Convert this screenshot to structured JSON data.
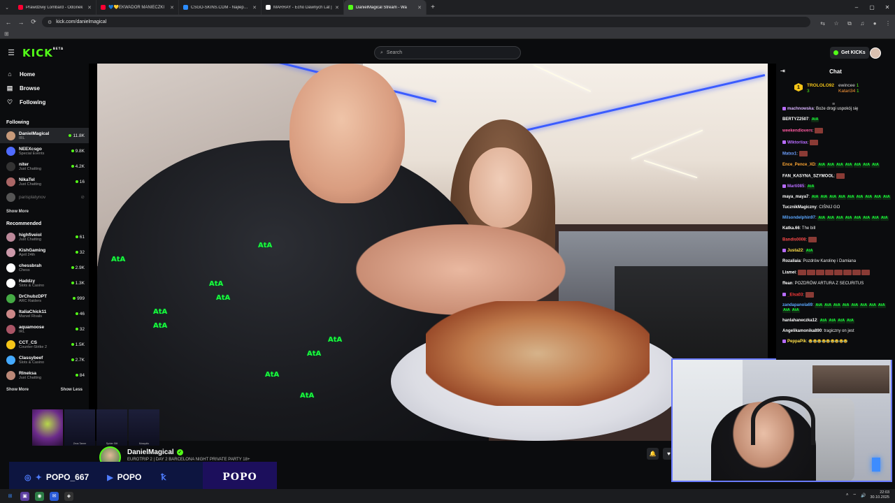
{
  "browser": {
    "tabs": [
      {
        "title": "Prawdziwy Lombard - Odcinek",
        "color": "#ff0033"
      },
      {
        "title": "💙💛EKWADOR MANIECZKI",
        "color": "#ff0033"
      },
      {
        "title": "CSGO-SKINS.COM - Najlepsze",
        "color": "#2b8cff"
      },
      {
        "title": "MARRAY - Echo Dawnych Lat |",
        "color": "#ffffff"
      },
      {
        "title": "DanielMagical Stream - Wa",
        "color": "#53fc18"
      }
    ],
    "url": "kick.com/danielmagical",
    "new_tab": "+",
    "menu": "⌄",
    "window_controls": [
      "–",
      "▢",
      "✕"
    ]
  },
  "header": {
    "logo": "KICK",
    "logo_badge": "BETA",
    "search_placeholder": "Search",
    "get_kicks": "Get KICKs"
  },
  "sidebar": {
    "nav": [
      {
        "label": "Home",
        "icon": "home-icon",
        "glyph": "⌂"
      },
      {
        "label": "Browse",
        "icon": "browse-icon",
        "glyph": "▤"
      },
      {
        "label": "Following",
        "icon": "heart-icon",
        "glyph": "♡"
      }
    ],
    "following_title": "Following",
    "following": [
      {
        "name": "DanielMagical",
        "category": "IRL",
        "viewers": "11.8K",
        "color": "#c79a7a",
        "active": true
      },
      {
        "name": "NEEXcsgo",
        "category": "Special Events",
        "viewers": "9.8K",
        "color": "#4f6bff"
      },
      {
        "name": "niter",
        "category": "Just Chatting",
        "viewers": "4.2K",
        "color": "#333"
      },
      {
        "name": "NikaTel",
        "category": "Just Chatting",
        "viewers": "16",
        "color": "#a66"
      },
      {
        "name": "parisplatynov",
        "category": "",
        "viewers": "",
        "color": "#555",
        "offline": true
      }
    ],
    "show_more": "Show More",
    "recommended_title": "Recommended",
    "recommended": [
      {
        "name": "highfiveiol",
        "category": "Just Chatting",
        "viewers": "61",
        "color": "#b89"
      },
      {
        "name": "KishGaming",
        "category": "April 24th",
        "viewers": "32",
        "color": "#c9a"
      },
      {
        "name": "chessbrah",
        "category": "Chess",
        "viewers": "2.9K",
        "color": "#fff"
      },
      {
        "name": "Haddzy",
        "category": "Slots & Casino",
        "viewers": "1.3K",
        "color": "#fff"
      },
      {
        "name": "DrChubzDPT",
        "category": "ARC Raiders",
        "viewers": "999",
        "color": "#4a4"
      },
      {
        "name": "ItaliaChick11",
        "category": "Marvel Rivals",
        "viewers": "46",
        "color": "#c88"
      },
      {
        "name": "aquamoose",
        "category": "IRL",
        "viewers": "32",
        "color": "#a56"
      },
      {
        "name": "CCT_CS",
        "category": "Counter-Strike 2",
        "viewers": "1.5K",
        "color": "#f5c518"
      },
      {
        "name": "Classybeef",
        "category": "Slots & Casino",
        "viewers": "2.7K",
        "color": "#4af"
      },
      {
        "name": "Rlneksa",
        "category": "Just Chatting",
        "viewers": "84",
        "color": "#b87"
      }
    ],
    "show_less": "Show Less"
  },
  "video": {
    "emote_text": "AtA"
  },
  "stream_info": {
    "channel": "DanielMagical",
    "title": "EUROTRIP 2 | DAY 2 BARCELONA NIGHT PRIVATE PARTY 18+"
  },
  "overlay": {
    "social_handle": "POPO_667",
    "yt_handle": "POPO",
    "brand": "POPO",
    "thumb_captions": [
      "",
      "Zeus Tamer",
      "Spider Gift",
      "Mosquito"
    ]
  },
  "chat": {
    "title": "Chat",
    "leaderboard": [
      {
        "name": "TROLOLO92",
        "count": "3",
        "rank": "1"
      },
      {
        "name": "ewincee",
        "count": "1"
      },
      {
        "name": "Katari34",
        "count": "1"
      }
    ],
    "messages": [
      {
        "user": "machnowska",
        "color": "#d9b3ff",
        "text": ": Boże drogi uspokój się",
        "emotes": 0,
        "badge": true
      },
      {
        "user": "BERTYZ2507",
        "color": "#ffffff",
        "text": ":",
        "emotes": 1
      },
      {
        "user": "weekendlovers",
        "color": "#ff5aa0",
        "text": ":",
        "pics": 1
      },
      {
        "user": "Wiktoriiaa",
        "color": "#b86cff",
        "text": ":",
        "pics": 1,
        "badge": true
      },
      {
        "user": "Matxx1",
        "color": "#6fa0ff",
        "text": ":",
        "pics": 1
      },
      {
        "user": "Ence_Pence_XD",
        "color": "#ffa733",
        "text": ":",
        "emotes": 7
      },
      {
        "user": "FAN_KASYNA_SZYMOOL",
        "color": "#ffffff",
        "text": ":",
        "pics": 1
      },
      {
        "user": "Marti085",
        "color": "#b86cff",
        "text": ":",
        "emotes": 1,
        "badge": true
      },
      {
        "user": "maya_maya7",
        "color": "#ffffff",
        "text": ":",
        "emotes": 9
      },
      {
        "user": "TucznikMagiczny",
        "color": "#ffffff",
        "text": ": CIŚNIJ GO"
      },
      {
        "user": "Milsondelphin97",
        "color": "#5aa7ff",
        "text": ":",
        "emotes": 8
      },
      {
        "user": "Katka.66",
        "color": "#ffffff",
        "text": ": The bill"
      },
      {
        "user": "Bandis0008",
        "color": "#ff4a4a",
        "text": ":",
        "pics": 1
      },
      {
        "user": "Justa22",
        "color": "#ffe04a",
        "text": ":",
        "emotes": 1,
        "badge": true
      },
      {
        "user": "Rozaliaia",
        "color": "#ffffff",
        "text": ": Pozdrów Karolinę i Damiana"
      },
      {
        "user": "Liamei",
        "color": "#ffffff",
        "text": ":",
        "pics": 8
      },
      {
        "user": "ffean",
        "color": "#ffffff",
        "text": ": POZDRÓW ARTURA Z SECURITUS"
      },
      {
        "user": "_Elsa03",
        "color": "#ff3a3a",
        "text": ":",
        "pics": 1,
        "badge": true
      },
      {
        "user": "zandapanola69",
        "color": "#5aa7ff",
        "text": ":",
        "emotes": 10
      },
      {
        "user": "hanlahaneczka12",
        "color": "#ffffff",
        "text": ":",
        "emotes": 4
      },
      {
        "user": "Angelikamonika890",
        "color": "#ffffff",
        "text": ": tragiczny on jest"
      },
      {
        "user": "PeppaPik",
        "color": "#ffe04a",
        "text": ":",
        "emotes": 0,
        "faces": 9,
        "badge": true
      }
    ]
  },
  "taskbar": {
    "time": "22:03",
    "date": "30.10.2025"
  },
  "colors": {
    "accent": "#53fc18",
    "bg": "#0b0c0e"
  }
}
